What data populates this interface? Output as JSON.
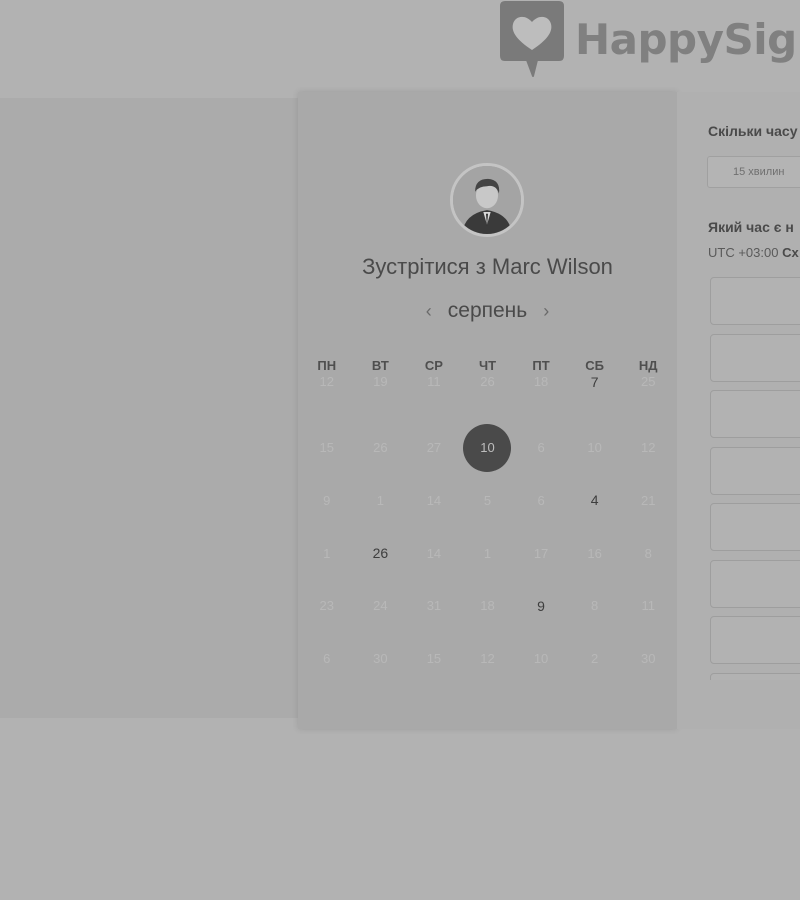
{
  "brand": {
    "name": "HappySign"
  },
  "host": {
    "meet_title": "Зустрітися з Marc Wilson"
  },
  "calendar": {
    "prev_icon": "‹",
    "next_icon": "›",
    "month": "серпень",
    "weekdays": [
      "ПН",
      "ВТ",
      "СР",
      "ЧТ",
      "ПТ",
      "СБ",
      "НД"
    ],
    "rows": [
      [
        {
          "d": "12"
        },
        {
          "d": "19"
        },
        {
          "d": "11"
        },
        {
          "d": "26"
        },
        {
          "d": "18"
        },
        {
          "d": "7",
          "state": "available"
        },
        {
          "d": "25"
        }
      ],
      [
        {
          "d": "15"
        },
        {
          "d": "26"
        },
        {
          "d": "27"
        },
        {
          "d": "10",
          "state": "selected"
        },
        {
          "d": "6"
        },
        {
          "d": "10"
        },
        {
          "d": "12"
        }
      ],
      [
        {
          "d": "9"
        },
        {
          "d": "1"
        },
        {
          "d": "14"
        },
        {
          "d": "5"
        },
        {
          "d": "6"
        },
        {
          "d": "4",
          "state": "available"
        },
        {
          "d": "21"
        }
      ],
      [
        {
          "d": "1"
        },
        {
          "d": "26",
          "state": "available"
        },
        {
          "d": "14"
        },
        {
          "d": "1"
        },
        {
          "d": "17"
        },
        {
          "d": "16"
        },
        {
          "d": "8"
        }
      ],
      [
        {
          "d": "23"
        },
        {
          "d": "24"
        },
        {
          "d": "31"
        },
        {
          "d": "18"
        },
        {
          "d": "9",
          "state": "available"
        },
        {
          "d": "8"
        },
        {
          "d": "11"
        }
      ],
      [
        {
          "d": "6"
        },
        {
          "d": "30"
        },
        {
          "d": "15"
        },
        {
          "d": "12"
        },
        {
          "d": "10"
        },
        {
          "d": "2"
        },
        {
          "d": "30"
        }
      ]
    ]
  },
  "booking": {
    "duration_question": "Скільки часу",
    "duration_option": "15 хвилин",
    "time_question": "Який час є н",
    "timezone_prefix": "UTC +03:00",
    "timezone_name": "Сх",
    "slot_count": 8
  }
}
